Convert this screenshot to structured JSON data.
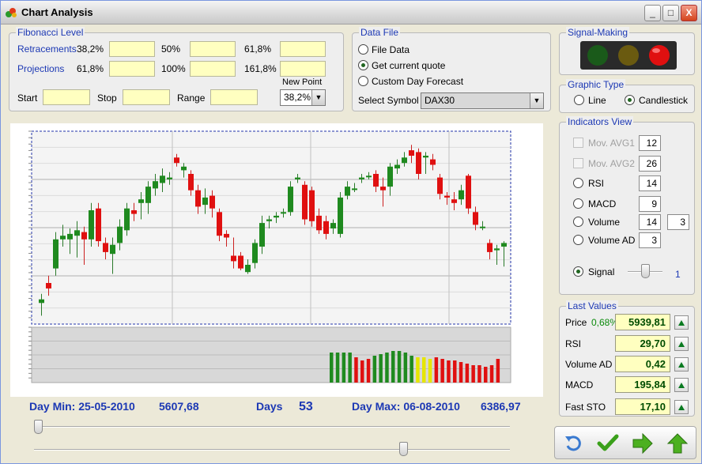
{
  "window": {
    "title": "Chart Analysis",
    "min_label": "_",
    "max_label": "□",
    "close_label": "X"
  },
  "fibonacci": {
    "group_title": "Fibonacci Level",
    "retracements_label": "Retracements",
    "retracements": [
      "38,2%",
      "50%",
      "61,8%"
    ],
    "projections_label": "Projections",
    "projections": [
      "61,8%",
      "100%",
      "161,8%"
    ],
    "start_label": "Start",
    "stop_label": "Stop",
    "range_label": "Range",
    "new_point_label": "New Point",
    "new_point_value": "38,2%"
  },
  "data_file": {
    "group_title": "Data File",
    "options": [
      "File Data",
      "Get current quote",
      "Custom Day Forecast"
    ],
    "selected_index": 1,
    "symbol_label": "Select Symbol",
    "symbol_value": "DAX30"
  },
  "signal_making": {
    "group_title": "Signal-Making",
    "lights": [
      "#1a5a1a",
      "#6a5a10",
      "#e01010"
    ]
  },
  "graphic_type": {
    "group_title": "Graphic Type",
    "line_label": "Line",
    "candle_label": "Candlestick",
    "selected": "candlestick"
  },
  "indicators": {
    "group_title": "Indicators View",
    "mov_avg1": {
      "label": "Mov. AVG1",
      "value": "12"
    },
    "mov_avg2": {
      "label": "Mov. AVG2",
      "value": "26"
    },
    "rsi": {
      "label": "RSI",
      "value": "14"
    },
    "macd": {
      "label": "MACD",
      "value": "9"
    },
    "volume": {
      "label": "Volume",
      "value": "14",
      "value2": "3"
    },
    "volume_ad": {
      "label": "Volume AD",
      "value": "3"
    },
    "signal": {
      "label": "Signal",
      "value": "1",
      "level": 0.5
    }
  },
  "last_values": {
    "group_title": "Last Values",
    "price_label": "Price",
    "price_change": "0,68%",
    "price": "5939,81",
    "rsi_label": "RSI",
    "rsi": "29,70",
    "volume_ad_label": "Volume AD",
    "volume_ad": "0,42",
    "macd_label": "MACD",
    "macd": "195,84",
    "fast_sto_label": "Fast STO",
    "fast_sto": "17,10"
  },
  "stats": {
    "day_min": "Day Min: 25-05-2010",
    "day_min_value": "5607,68",
    "days_label": "Days",
    "days_value": "53",
    "day_max": "Day Max: 06-08-2010",
    "day_max_value": "6386,97"
  },
  "sliders": {
    "top_level": 0.0,
    "bottom_level": 0.78
  },
  "colors": {
    "up": "#1f8a1f",
    "down": "#e01010",
    "neutral": "#e6e600"
  },
  "chart_data": {
    "type": "candlestick",
    "title": "",
    "candles": [
      {
        "o": 9,
        "c": 11,
        "h": 14,
        "l": 2
      },
      {
        "o": 20,
        "c": 17,
        "h": 24,
        "l": 13
      },
      {
        "o": 28,
        "c": 44,
        "h": 48,
        "l": 24
      },
      {
        "o": 44,
        "c": 46,
        "h": 52,
        "l": 40
      },
      {
        "o": 44,
        "c": 47,
        "h": 50,
        "l": 36
      },
      {
        "o": 46,
        "c": 49,
        "h": 54,
        "l": 34
      },
      {
        "o": 48,
        "c": 44,
        "h": 51,
        "l": 30
      },
      {
        "o": 44,
        "c": 60,
        "h": 64,
        "l": 40
      },
      {
        "o": 61,
        "c": 43,
        "h": 64,
        "l": 40
      },
      {
        "o": 42,
        "c": 37,
        "h": 45,
        "l": 33
      },
      {
        "o": 36,
        "c": 41,
        "h": 45,
        "l": 25
      },
      {
        "o": 42,
        "c": 51,
        "h": 55,
        "l": 38
      },
      {
        "o": 49,
        "c": 61,
        "h": 64,
        "l": 46
      },
      {
        "o": 60,
        "c": 58,
        "h": 64,
        "l": 54
      },
      {
        "o": 64,
        "c": 66,
        "h": 70,
        "l": 55
      },
      {
        "o": 64,
        "c": 73,
        "h": 76,
        "l": 58
      },
      {
        "o": 72,
        "c": 76,
        "h": 80,
        "l": 68
      },
      {
        "o": 75,
        "c": 79,
        "h": 83,
        "l": 70
      },
      {
        "o": 77,
        "c": 78,
        "h": 81,
        "l": 74
      },
      {
        "o": 89,
        "c": 86,
        "h": 91,
        "l": 84
      },
      {
        "o": 82,
        "c": 84,
        "h": 86,
        "l": 78
      },
      {
        "o": 80,
        "c": 71,
        "h": 82,
        "l": 68
      },
      {
        "o": 71,
        "c": 62,
        "h": 74,
        "l": 58
      },
      {
        "o": 63,
        "c": 67,
        "h": 72,
        "l": 58
      },
      {
        "o": 68,
        "c": 61,
        "h": 71,
        "l": 56
      },
      {
        "o": 59,
        "c": 46,
        "h": 61,
        "l": 43
      },
      {
        "o": 47,
        "c": 45,
        "h": 49,
        "l": 40
      },
      {
        "o": 35,
        "c": 32,
        "h": 45,
        "l": 28
      },
      {
        "o": 35,
        "c": 28,
        "h": 37,
        "l": 27
      },
      {
        "o": 26,
        "c": 30,
        "h": 33,
        "l": 25
      },
      {
        "o": 31,
        "c": 42,
        "h": 44,
        "l": 28
      },
      {
        "o": 40,
        "c": 53,
        "h": 57,
        "l": 36
      },
      {
        "o": 54,
        "c": 55,
        "h": 57,
        "l": 50
      },
      {
        "o": 56,
        "c": 57,
        "h": 59,
        "l": 53
      },
      {
        "o": 59,
        "c": 59,
        "h": 61,
        "l": 56
      },
      {
        "o": 59,
        "c": 73,
        "h": 76,
        "l": 57
      },
      {
        "o": 77,
        "c": 78,
        "h": 80,
        "l": 75
      },
      {
        "o": 74,
        "c": 55,
        "h": 76,
        "l": 52
      },
      {
        "o": 71,
        "c": 54,
        "h": 73,
        "l": 51
      },
      {
        "o": 57,
        "c": 49,
        "h": 61,
        "l": 47
      },
      {
        "o": 54,
        "c": 47,
        "h": 57,
        "l": 44
      },
      {
        "o": 50,
        "c": 53,
        "h": 55,
        "l": 47
      },
      {
        "o": 47,
        "c": 67,
        "h": 70,
        "l": 45
      },
      {
        "o": 68,
        "c": 73,
        "h": 76,
        "l": 66
      },
      {
        "o": 72,
        "c": 72,
        "h": 75,
        "l": 70
      },
      {
        "o": 77,
        "c": 78,
        "h": 80,
        "l": 75
      },
      {
        "o": 79,
        "c": 79,
        "h": 81,
        "l": 77
      },
      {
        "o": 80,
        "c": 73,
        "h": 82,
        "l": 70
      },
      {
        "o": 73,
        "c": 71,
        "h": 78,
        "l": 62
      },
      {
        "o": 73,
        "c": 84,
        "h": 86,
        "l": 68
      },
      {
        "o": 83,
        "c": 85,
        "h": 88,
        "l": 80
      },
      {
        "o": 86,
        "c": 89,
        "h": 92,
        "l": 84
      },
      {
        "o": 93,
        "c": 90,
        "h": 96,
        "l": 86
      },
      {
        "o": 92,
        "c": 80,
        "h": 94,
        "l": 77
      },
      {
        "o": 89,
        "c": 90,
        "h": 92,
        "l": 80
      },
      {
        "o": 88,
        "c": 85,
        "h": 91,
        "l": 82
      },
      {
        "o": 78,
        "c": 69,
        "h": 80,
        "l": 66
      },
      {
        "o": 68,
        "c": 67,
        "h": 70,
        "l": 63
      },
      {
        "o": 66,
        "c": 64,
        "h": 70,
        "l": 60
      },
      {
        "o": 66,
        "c": 71,
        "h": 74,
        "l": 63
      },
      {
        "o": 79,
        "c": 61,
        "h": 80,
        "l": 58
      },
      {
        "o": 59,
        "c": 52,
        "h": 62,
        "l": 49
      },
      {
        "o": 51,
        "c": 51,
        "h": 54,
        "l": 49
      },
      {
        "o": 42,
        "c": 37,
        "h": 44,
        "l": 33
      },
      {
        "o": 38,
        "c": 39,
        "h": 41,
        "l": 30
      },
      {
        "o": 40,
        "c": 42,
        "h": 43,
        "l": 29
      }
    ],
    "volume_bars": [
      {
        "v": 0.95,
        "c": "up"
      },
      {
        "v": 0.95,
        "c": "up"
      },
      {
        "v": 0.95,
        "c": "up"
      },
      {
        "v": 0.95,
        "c": "up"
      },
      {
        "v": 0.8,
        "c": "down"
      },
      {
        "v": 0.7,
        "c": "down"
      },
      {
        "v": 0.75,
        "c": "down"
      },
      {
        "v": 0.85,
        "c": "up"
      },
      {
        "v": 0.9,
        "c": "up"
      },
      {
        "v": 0.95,
        "c": "up"
      },
      {
        "v": 1.0,
        "c": "up"
      },
      {
        "v": 1.0,
        "c": "up"
      },
      {
        "v": 0.95,
        "c": "up"
      },
      {
        "v": 0.85,
        "c": "up"
      },
      {
        "v": 0.8,
        "c": "neutral"
      },
      {
        "v": 0.8,
        "c": "neutral"
      },
      {
        "v": 0.75,
        "c": "neutral"
      },
      {
        "v": 0.8,
        "c": "down"
      },
      {
        "v": 0.75,
        "c": "down"
      },
      {
        "v": 0.7,
        "c": "down"
      },
      {
        "v": 0.7,
        "c": "down"
      },
      {
        "v": 0.65,
        "c": "down"
      },
      {
        "v": 0.6,
        "c": "down"
      },
      {
        "v": 0.55,
        "c": "down"
      },
      {
        "v": 0.55,
        "c": "down"
      },
      {
        "v": 0.5,
        "c": "down"
      },
      {
        "v": 0.55,
        "c": "down"
      },
      {
        "v": 0.75,
        "c": "down"
      }
    ]
  }
}
